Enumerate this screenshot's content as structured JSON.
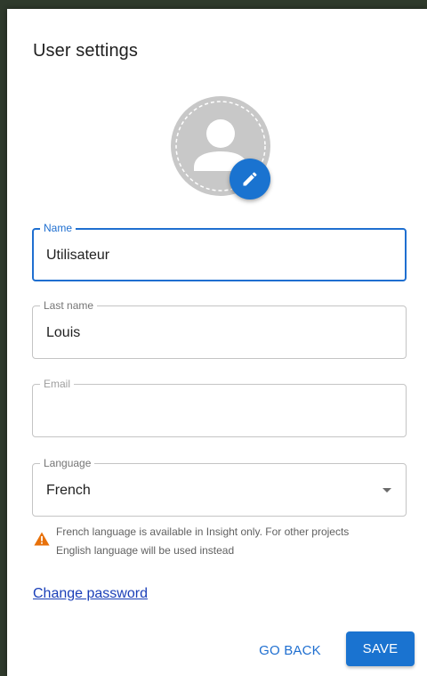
{
  "dialog": {
    "title": "User settings"
  },
  "avatar": {
    "icon": "person-icon",
    "edit_icon": "pencil-icon"
  },
  "fields": {
    "name": {
      "label": "Name",
      "value": "Utilisateur"
    },
    "last_name": {
      "label": "Last name",
      "value": "Louis"
    },
    "email": {
      "label": "Email",
      "value": ""
    },
    "language": {
      "label": "Language",
      "value": "French"
    }
  },
  "warning": {
    "icon": "warning-icon",
    "text": "French language is available in Insight only. For other projects English language will be used instead"
  },
  "links": {
    "change_password": "Change password"
  },
  "actions": {
    "go_back": "GO BACK",
    "save": "SAVE"
  },
  "colors": {
    "accent": "#1a73d0",
    "warning": "#e8710a",
    "link": "#1a3fb8"
  }
}
